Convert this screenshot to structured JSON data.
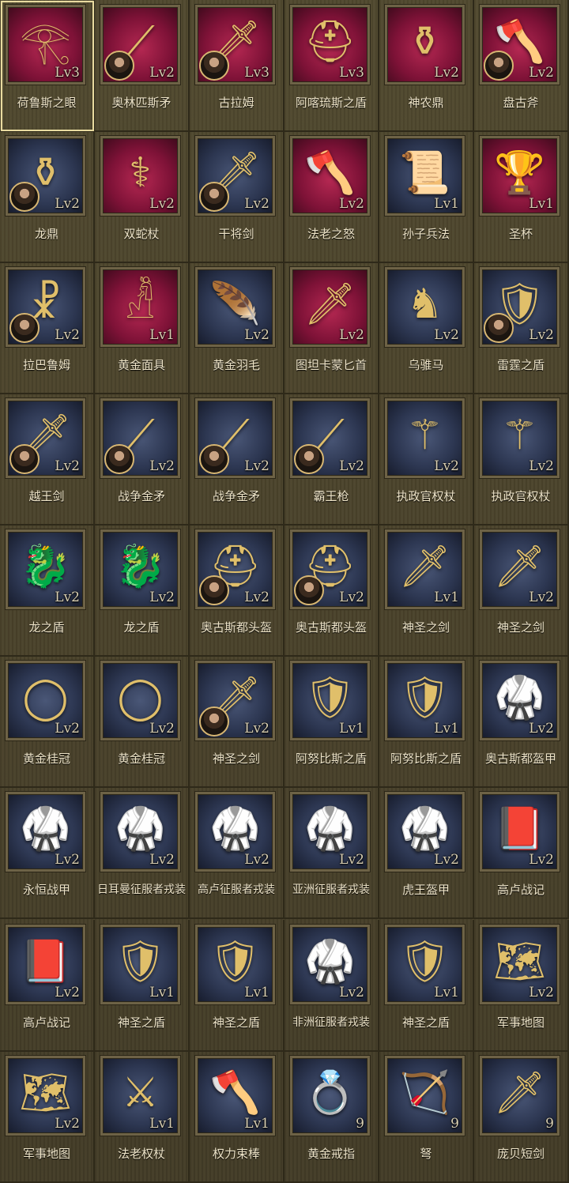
{
  "items": [
    {
      "name": "荷鲁斯之眼",
      "level": "Lv3",
      "bg": "red",
      "icon": "eye-of-horus-icon",
      "glyph": "𓂀",
      "hero": false,
      "selected": true
    },
    {
      "name": "奥林匹斯矛",
      "level": "Lv2",
      "bg": "red",
      "icon": "spear-icon",
      "glyph": "⟋",
      "hero": true
    },
    {
      "name": "古拉姆",
      "level": "Lv3",
      "bg": "red",
      "icon": "sword-icon",
      "glyph": "🗡",
      "hero": true
    },
    {
      "name": "阿喀琉斯之盾",
      "level": "Lv3",
      "bg": "red",
      "icon": "helmet-icon",
      "glyph": "⛑",
      "hero": false
    },
    {
      "name": "神农鼎",
      "level": "Lv2",
      "bg": "red",
      "icon": "cauldron-icon",
      "glyph": "⚱",
      "hero": false
    },
    {
      "name": "盘古斧",
      "level": "Lv2",
      "bg": "red",
      "icon": "axe-icon",
      "glyph": "🪓",
      "hero": true
    },
    {
      "name": "龙鼎",
      "level": "Lv2",
      "bg": "blue",
      "icon": "cauldron-icon",
      "glyph": "⚱",
      "hero": true
    },
    {
      "name": "双蛇杖",
      "level": "Lv2",
      "bg": "red",
      "icon": "caduceus-icon",
      "glyph": "⚕",
      "hero": false
    },
    {
      "name": "干将剑",
      "level": "Lv2",
      "bg": "blue",
      "icon": "sword-icon",
      "glyph": "🗡",
      "hero": true
    },
    {
      "name": "法老之怒",
      "level": "Lv2",
      "bg": "red",
      "icon": "axe-icon",
      "glyph": "🪓",
      "hero": false
    },
    {
      "name": "孙子兵法",
      "level": "Lv1",
      "bg": "blue",
      "icon": "scroll-icon",
      "glyph": "📜",
      "hero": false
    },
    {
      "name": "圣杯",
      "level": "Lv1",
      "bg": "red",
      "icon": "chalice-icon",
      "glyph": "🏆",
      "hero": false
    },
    {
      "name": "拉巴鲁姆",
      "level": "Lv2",
      "bg": "blue",
      "icon": "labarum-icon",
      "glyph": "☧",
      "hero": true
    },
    {
      "name": "黄金面具",
      "level": "Lv1",
      "bg": "red",
      "icon": "mask-icon",
      "glyph": "𓁚",
      "hero": false
    },
    {
      "name": "黄金羽毛",
      "level": "Lv2",
      "bg": "blue",
      "icon": "feather-wing-icon",
      "glyph": "🪶",
      "hero": false
    },
    {
      "name": "图坦卡蒙匕首",
      "level": "Lv2",
      "bg": "red",
      "icon": "dagger-icon",
      "glyph": "🗡",
      "hero": false
    },
    {
      "name": "乌骓马",
      "level": "Lv2",
      "bg": "blue",
      "icon": "horse-icon",
      "glyph": "♞",
      "hero": false
    },
    {
      "name": "雷霆之盾",
      "level": "Lv2",
      "bg": "blue",
      "icon": "shield-icon",
      "glyph": "🛡",
      "hero": true
    },
    {
      "name": "越王剑",
      "level": "Lv2",
      "bg": "blue",
      "icon": "sword-icon",
      "glyph": "🗡",
      "hero": true
    },
    {
      "name": "战争金矛",
      "level": "Lv2",
      "bg": "blue",
      "icon": "spear-icon",
      "glyph": "⟋",
      "hero": true
    },
    {
      "name": "战争金矛",
      "level": "Lv2",
      "bg": "blue",
      "icon": "spear-icon",
      "glyph": "⟋",
      "hero": true
    },
    {
      "name": "霸王枪",
      "level": "Lv2",
      "bg": "blue",
      "icon": "spear-icon",
      "glyph": "⟋",
      "hero": true
    },
    {
      "name": "执政官权杖",
      "level": "Lv2",
      "bg": "blue",
      "icon": "scepter-icon",
      "glyph": "⚚",
      "hero": false
    },
    {
      "name": "执政官权杖",
      "level": "Lv2",
      "bg": "blue",
      "icon": "scepter-icon",
      "glyph": "⚚",
      "hero": false
    },
    {
      "name": "龙之盾",
      "level": "Lv2",
      "bg": "blue",
      "icon": "dragon-shield-icon",
      "glyph": "🐉",
      "hero": false
    },
    {
      "name": "龙之盾",
      "level": "Lv2",
      "bg": "blue",
      "icon": "dragon-shield-icon",
      "glyph": "🐉",
      "hero": false
    },
    {
      "name": "奥古斯都头盔",
      "level": "Lv2",
      "bg": "blue",
      "icon": "helmet-icon",
      "glyph": "⛑",
      "hero": true
    },
    {
      "name": "奥古斯都头盔",
      "level": "Lv2",
      "bg": "blue",
      "icon": "helmet-icon",
      "glyph": "⛑",
      "hero": true
    },
    {
      "name": "神圣之剑",
      "level": "Lv1",
      "bg": "blue",
      "icon": "sword-icon",
      "glyph": "🗡",
      "hero": false
    },
    {
      "name": "神圣之剑",
      "level": "Lv2",
      "bg": "blue",
      "icon": "sword-icon",
      "glyph": "🗡",
      "hero": false
    },
    {
      "name": "黄金桂冠",
      "level": "Lv2",
      "bg": "blue",
      "icon": "laurel-wreath-icon",
      "glyph": "◯",
      "hero": false
    },
    {
      "name": "黄金桂冠",
      "level": "Lv2",
      "bg": "blue",
      "icon": "laurel-wreath-icon",
      "glyph": "◯",
      "hero": false
    },
    {
      "name": "神圣之剑",
      "level": "Lv2",
      "bg": "blue",
      "icon": "sword-icon",
      "glyph": "🗡",
      "hero": true
    },
    {
      "name": "阿努比斯之盾",
      "level": "Lv1",
      "bg": "blue",
      "icon": "shield-icon",
      "glyph": "🛡",
      "hero": false
    },
    {
      "name": "阿努比斯之盾",
      "level": "Lv1",
      "bg": "blue",
      "icon": "shield-icon",
      "glyph": "🛡",
      "hero": false
    },
    {
      "name": "奥古斯都盔甲",
      "level": "Lv2",
      "bg": "blue",
      "icon": "armor-icon",
      "glyph": "🥋",
      "hero": false
    },
    {
      "name": "永恒战甲",
      "level": "Lv2",
      "bg": "blue",
      "icon": "armor-icon",
      "glyph": "🥋",
      "hero": false
    },
    {
      "name": "日耳曼征服者戎装",
      "level": "Lv2",
      "bg": "blue",
      "icon": "armor-icon",
      "glyph": "🥋",
      "hero": false
    },
    {
      "name": "高卢征服者戎装",
      "level": "Lv2",
      "bg": "blue",
      "icon": "armor-icon",
      "glyph": "🥋",
      "hero": false
    },
    {
      "name": "亚洲征服者戎装",
      "level": "Lv2",
      "bg": "blue",
      "icon": "armor-icon",
      "glyph": "🥋",
      "hero": false
    },
    {
      "name": "虎王盔甲",
      "level": "Lv2",
      "bg": "blue",
      "icon": "armor-icon",
      "glyph": "🥋",
      "hero": false
    },
    {
      "name": "高卢战记",
      "level": "Lv2",
      "bg": "blue",
      "icon": "book-icon",
      "glyph": "📕",
      "hero": false
    },
    {
      "name": "高卢战记",
      "level": "Lv2",
      "bg": "blue",
      "icon": "book-icon",
      "glyph": "📕",
      "hero": false
    },
    {
      "name": "神圣之盾",
      "level": "Lv1",
      "bg": "blue",
      "icon": "eagle-shield-icon",
      "glyph": "🛡",
      "hero": false
    },
    {
      "name": "神圣之盾",
      "level": "Lv1",
      "bg": "blue",
      "icon": "eagle-shield-icon",
      "glyph": "🛡",
      "hero": false
    },
    {
      "name": "非洲征服者戎装",
      "level": "Lv2",
      "bg": "blue",
      "icon": "armor-icon",
      "glyph": "🥋",
      "hero": false
    },
    {
      "name": "神圣之盾",
      "level": "Lv1",
      "bg": "blue",
      "icon": "eagle-shield-icon",
      "glyph": "🛡",
      "hero": false
    },
    {
      "name": "军事地图",
      "level": "Lv2",
      "bg": "blue",
      "icon": "map-scroll-icon",
      "glyph": "🗺",
      "hero": false
    },
    {
      "name": "军事地图",
      "level": "Lv2",
      "bg": "blue",
      "icon": "map-scroll-icon",
      "glyph": "🗺",
      "hero": false
    },
    {
      "name": "法老权杖",
      "level": "Lv1",
      "bg": "blue",
      "icon": "crook-flail-icon",
      "glyph": "⚔",
      "hero": false
    },
    {
      "name": "权力束棒",
      "level": "Lv1",
      "bg": "blue",
      "icon": "fasces-icon",
      "glyph": "🪓",
      "hero": false
    },
    {
      "name": "黄金戒指",
      "level": "9",
      "bg": "blue",
      "icon": "ring-icon",
      "glyph": "💍",
      "hero": false
    },
    {
      "name": "弩",
      "level": "9",
      "bg": "blue",
      "icon": "crossbow-icon",
      "glyph": "🏹",
      "hero": false
    },
    {
      "name": "庞贝短剑",
      "level": "9",
      "bg": "blue",
      "icon": "short-sword-icon",
      "glyph": "🗡",
      "hero": false
    }
  ]
}
